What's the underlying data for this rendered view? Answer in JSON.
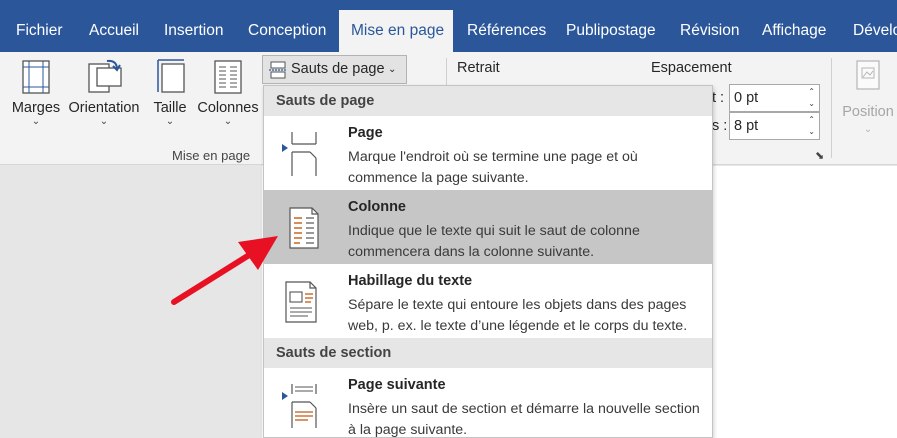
{
  "tabs": [
    {
      "label": "Fichier"
    },
    {
      "label": "Accueil"
    },
    {
      "label": "Insertion"
    },
    {
      "label": "Conception"
    },
    {
      "label": "Mise en page",
      "active": true
    },
    {
      "label": "Références"
    },
    {
      "label": "Publipostage"
    },
    {
      "label": "Révision"
    },
    {
      "label": "Affichage"
    },
    {
      "label": "Dévelo"
    }
  ],
  "ribbon": {
    "buttons": {
      "marges": "Marges",
      "orientation": "Orientation",
      "taille": "Taille",
      "colonnes": "Colonnes"
    },
    "group_label": "Mise en page",
    "sauts_label": "Sauts de page",
    "retrait_label": "Retrait",
    "espacement_label": "Espacement",
    "avant_suffix": "t :",
    "apres_suffix": "s :",
    "avant_value": "0 pt",
    "apres_value": "8 pt",
    "position_label": "Position"
  },
  "menu": {
    "section_page": "Sauts de page",
    "section_section": "Sauts de section",
    "items": [
      {
        "title": "Page",
        "desc": "Marque l'endroit où se termine une page et où commence la page suivante.",
        "highlighted": false
      },
      {
        "title": "Colonne",
        "desc": "Indique que le texte qui suit le saut de colonne commencera dans la colonne suivante.",
        "highlighted": true
      },
      {
        "title": "Habillage du texte",
        "desc": "Sépare le texte qui entoure les objets dans des pages web, p. ex. le texte d’une légende et le corps du texte.",
        "highlighted": false
      },
      {
        "title": "Page suivante",
        "desc": "Insère un saut de section et démarre la nouvelle section à la page suivante.",
        "highlighted": false
      }
    ]
  },
  "colors": {
    "tabbar": "#2b579a",
    "ribbon": "#f3f3f3",
    "highlight": "#c6c6c6",
    "annotation_arrow": "#e81123"
  }
}
